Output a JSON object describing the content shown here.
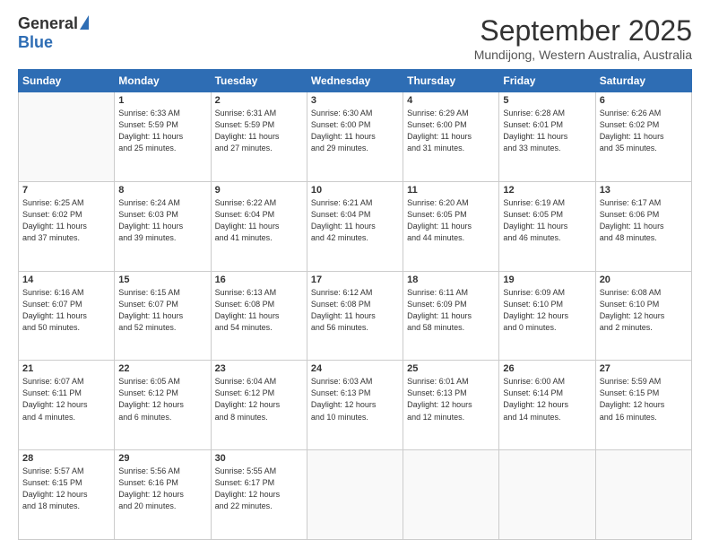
{
  "logo": {
    "general": "General",
    "blue": "Blue"
  },
  "title": "September 2025",
  "subtitle": "Mundijong, Western Australia, Australia",
  "days_of_week": [
    "Sunday",
    "Monday",
    "Tuesday",
    "Wednesday",
    "Thursday",
    "Friday",
    "Saturday"
  ],
  "weeks": [
    [
      {
        "day": "",
        "info": ""
      },
      {
        "day": "1",
        "info": "Sunrise: 6:33 AM\nSunset: 5:59 PM\nDaylight: 11 hours\nand 25 minutes."
      },
      {
        "day": "2",
        "info": "Sunrise: 6:31 AM\nSunset: 5:59 PM\nDaylight: 11 hours\nand 27 minutes."
      },
      {
        "day": "3",
        "info": "Sunrise: 6:30 AM\nSunset: 6:00 PM\nDaylight: 11 hours\nand 29 minutes."
      },
      {
        "day": "4",
        "info": "Sunrise: 6:29 AM\nSunset: 6:00 PM\nDaylight: 11 hours\nand 31 minutes."
      },
      {
        "day": "5",
        "info": "Sunrise: 6:28 AM\nSunset: 6:01 PM\nDaylight: 11 hours\nand 33 minutes."
      },
      {
        "day": "6",
        "info": "Sunrise: 6:26 AM\nSunset: 6:02 PM\nDaylight: 11 hours\nand 35 minutes."
      }
    ],
    [
      {
        "day": "7",
        "info": "Sunrise: 6:25 AM\nSunset: 6:02 PM\nDaylight: 11 hours\nand 37 minutes."
      },
      {
        "day": "8",
        "info": "Sunrise: 6:24 AM\nSunset: 6:03 PM\nDaylight: 11 hours\nand 39 minutes."
      },
      {
        "day": "9",
        "info": "Sunrise: 6:22 AM\nSunset: 6:04 PM\nDaylight: 11 hours\nand 41 minutes."
      },
      {
        "day": "10",
        "info": "Sunrise: 6:21 AM\nSunset: 6:04 PM\nDaylight: 11 hours\nand 42 minutes."
      },
      {
        "day": "11",
        "info": "Sunrise: 6:20 AM\nSunset: 6:05 PM\nDaylight: 11 hours\nand 44 minutes."
      },
      {
        "day": "12",
        "info": "Sunrise: 6:19 AM\nSunset: 6:05 PM\nDaylight: 11 hours\nand 46 minutes."
      },
      {
        "day": "13",
        "info": "Sunrise: 6:17 AM\nSunset: 6:06 PM\nDaylight: 11 hours\nand 48 minutes."
      }
    ],
    [
      {
        "day": "14",
        "info": "Sunrise: 6:16 AM\nSunset: 6:07 PM\nDaylight: 11 hours\nand 50 minutes."
      },
      {
        "day": "15",
        "info": "Sunrise: 6:15 AM\nSunset: 6:07 PM\nDaylight: 11 hours\nand 52 minutes."
      },
      {
        "day": "16",
        "info": "Sunrise: 6:13 AM\nSunset: 6:08 PM\nDaylight: 11 hours\nand 54 minutes."
      },
      {
        "day": "17",
        "info": "Sunrise: 6:12 AM\nSunset: 6:08 PM\nDaylight: 11 hours\nand 56 minutes."
      },
      {
        "day": "18",
        "info": "Sunrise: 6:11 AM\nSunset: 6:09 PM\nDaylight: 11 hours\nand 58 minutes."
      },
      {
        "day": "19",
        "info": "Sunrise: 6:09 AM\nSunset: 6:10 PM\nDaylight: 12 hours\nand 0 minutes."
      },
      {
        "day": "20",
        "info": "Sunrise: 6:08 AM\nSunset: 6:10 PM\nDaylight: 12 hours\nand 2 minutes."
      }
    ],
    [
      {
        "day": "21",
        "info": "Sunrise: 6:07 AM\nSunset: 6:11 PM\nDaylight: 12 hours\nand 4 minutes."
      },
      {
        "day": "22",
        "info": "Sunrise: 6:05 AM\nSunset: 6:12 PM\nDaylight: 12 hours\nand 6 minutes."
      },
      {
        "day": "23",
        "info": "Sunrise: 6:04 AM\nSunset: 6:12 PM\nDaylight: 12 hours\nand 8 minutes."
      },
      {
        "day": "24",
        "info": "Sunrise: 6:03 AM\nSunset: 6:13 PM\nDaylight: 12 hours\nand 10 minutes."
      },
      {
        "day": "25",
        "info": "Sunrise: 6:01 AM\nSunset: 6:13 PM\nDaylight: 12 hours\nand 12 minutes."
      },
      {
        "day": "26",
        "info": "Sunrise: 6:00 AM\nSunset: 6:14 PM\nDaylight: 12 hours\nand 14 minutes."
      },
      {
        "day": "27",
        "info": "Sunrise: 5:59 AM\nSunset: 6:15 PM\nDaylight: 12 hours\nand 16 minutes."
      }
    ],
    [
      {
        "day": "28",
        "info": "Sunrise: 5:57 AM\nSunset: 6:15 PM\nDaylight: 12 hours\nand 18 minutes."
      },
      {
        "day": "29",
        "info": "Sunrise: 5:56 AM\nSunset: 6:16 PM\nDaylight: 12 hours\nand 20 minutes."
      },
      {
        "day": "30",
        "info": "Sunrise: 5:55 AM\nSunset: 6:17 PM\nDaylight: 12 hours\nand 22 minutes."
      },
      {
        "day": "",
        "info": ""
      },
      {
        "day": "",
        "info": ""
      },
      {
        "day": "",
        "info": ""
      },
      {
        "day": "",
        "info": ""
      }
    ]
  ]
}
